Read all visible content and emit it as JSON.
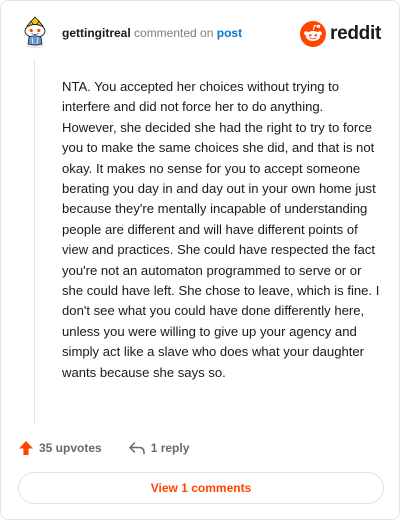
{
  "colors": {
    "accent": "#ff4500",
    "link": "#0079d3",
    "muted": "#7c7c7c"
  },
  "header": {
    "avatar_icon": "snoo-avatar-icon",
    "username": "gettingitreal",
    "action_text": "commented on",
    "post_link": "post",
    "brand_logo_icon": "reddit-logo-icon",
    "brand_name": "reddit"
  },
  "comment": {
    "body": "NTA. You accepted her choices without trying to interfere and did not force her to do anything. However, she decided she had the right to try to force you to make the same choices she did, and that is not okay. It makes no sense for you to accept someone berating you day in and day out in your own home just because they're mentally incapable of understanding people are different and will have different points of view and practices. She could have respected the fact you're not an automaton programmed to serve or or she could have left. She chose to leave, which is fine. I don't see what you could have done differently here, unless you were willing to give up your agency and simply act like a slave who does what your daughter wants because she says so."
  },
  "actions": {
    "upvote_icon": "upvote-arrow-icon",
    "upvotes_label": "35 upvotes",
    "reply_icon": "reply-arrow-icon",
    "reply_label": "1 reply"
  },
  "footer": {
    "view_comments_label": "View 1 comments"
  }
}
